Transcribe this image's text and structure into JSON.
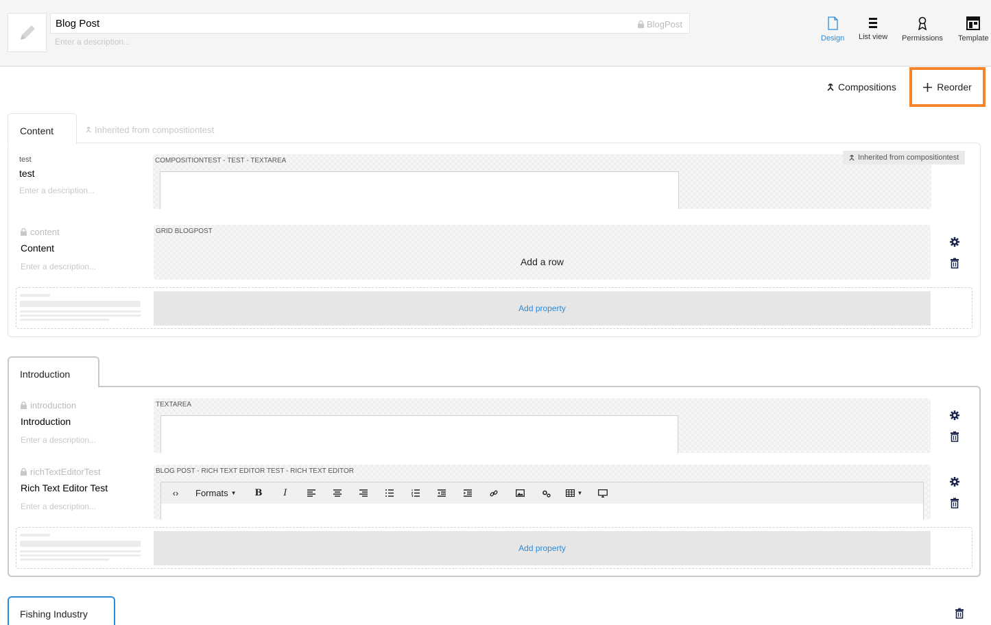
{
  "header": {
    "name_value": "Blog Post",
    "alias": "BlogPost",
    "description_placeholder": "Enter a description...",
    "apps": [
      {
        "label": "Design",
        "icon": "document-icon",
        "active": true
      },
      {
        "label": "List view",
        "icon": "list-icon",
        "active": false
      },
      {
        "label": "Permissions",
        "icon": "permissions-icon",
        "active": false
      },
      {
        "label": "Template",
        "icon": "template-icon",
        "active": false
      }
    ]
  },
  "toolbar": {
    "compositions_label": "Compositions",
    "reorder_label": "Reorder"
  },
  "groups": [
    {
      "name": "Content",
      "inherited_tab_label": "Inherited from compositiontest",
      "properties": [
        {
          "alias": "test",
          "name": "test",
          "description_placeholder": "Enter a description...",
          "editor": "COMPOSITIONTEST - TEST - TEXTAREA",
          "inherited_badge": "Inherited from compositiontest"
        },
        {
          "alias": "content",
          "name": "Content",
          "description_placeholder": "Enter a description...",
          "editor": "GRID BLOGPOST",
          "grid_label": "Add a row"
        }
      ],
      "add_property_label": "Add property"
    },
    {
      "name": "Introduction",
      "properties": [
        {
          "alias": "introduction",
          "name": "Introduction",
          "description_placeholder": "Enter a description...",
          "editor": "TEXTAREA"
        },
        {
          "alias": "richTextEditorTest",
          "name": "Rich Text Editor Test",
          "description_placeholder": "Enter a description...",
          "editor": "BLOG POST - RICH TEXT EDITOR TEST - RICH TEXT EDITOR",
          "rte_formats_label": "Formats"
        }
      ],
      "add_property_label": "Add property"
    },
    {
      "name": "Fishing Industry"
    }
  ],
  "colors": {
    "accent": "#2b8ad8",
    "highlight": "#f5842b",
    "text": "#1b264f"
  }
}
